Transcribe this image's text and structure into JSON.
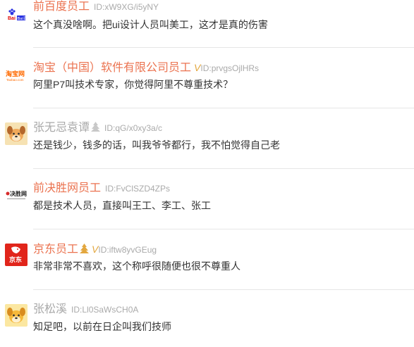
{
  "posts": [
    {
      "author": "前百度员工",
      "id_text": "ID:xW9XG/i5yNY",
      "text": "这个真没啥啊。把ui设计人员叫美工，这才是真的伤害",
      "verified": "",
      "avatar_icon": "baidu-logo-icon",
      "logo_text": "Bai百度"
    },
    {
      "author": "淘宝（中国）软件有限公司员工",
      "id_text": "ID:prvgsOjlHRs",
      "text": "阿里P7叫技术专家，你觉得阿里不尊重技术？",
      "verified": "V",
      "avatar_icon": "taobao-logo-icon",
      "logo_text": "淘宝网",
      "logo_sub": "Taobao.com"
    },
    {
      "author": "张无忌袁谭",
      "id_text": "ID:qG/x0xy3a/c",
      "text": "还是钱少，钱多的话，叫我爷爷都行，我不怕觉得自己老",
      "verified": "",
      "avatar_icon": "dog-avatar-icon"
    },
    {
      "author": "前决胜网员工",
      "id_text": "ID:FvClSZD4ZPs",
      "text": "都是技术人员，直接叫王工、李工、张工",
      "verified": "",
      "avatar_icon": "juesheng-logo-icon",
      "logo_text": "决胜网"
    },
    {
      "author": "京东员工",
      "id_text": "ID:iftw8yvGEug",
      "text": "非常非常不喜欢，这个称呼很随便也很不尊重人",
      "verified": "V",
      "avatar_icon": "jd-logo-icon",
      "logo_text": "京东"
    },
    {
      "author": "张松溪",
      "id_text": "ID:Ll0SaWsCH0A",
      "text": "知足吧，以前在日企叫我们技师",
      "verified": "",
      "avatar_icon": "dog-avatar-icon"
    }
  ],
  "colors": {
    "author_orange": "#eb7350",
    "author_grey": "#a9a9a9",
    "verified_gold": "#e3a73f",
    "id_grey": "#aaaaaa",
    "body_text": "#333333",
    "divider": "#e6e6e6"
  }
}
